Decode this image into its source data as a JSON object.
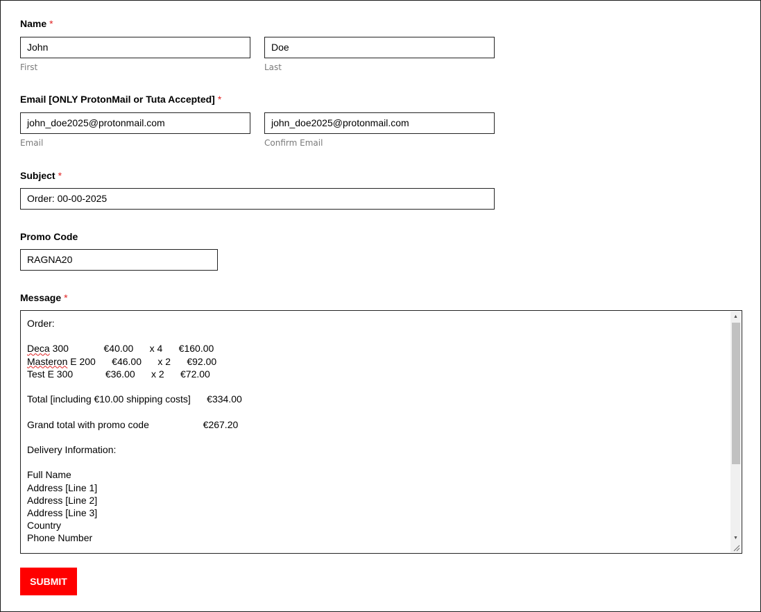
{
  "form": {
    "name": {
      "label": "Name",
      "required_mark": "*",
      "first_value": "John",
      "first_sublabel": "First",
      "last_value": "Doe",
      "last_sublabel": "Last"
    },
    "email": {
      "label": "Email [ONLY ProtonMail or Tuta Accepted]",
      "required_mark": "*",
      "email_value": "john_doe2025@protonmail.com",
      "email_sublabel": "Email",
      "confirm_value": "john_doe2025@protonmail.com",
      "confirm_sublabel": "Confirm Email"
    },
    "subject": {
      "label": "Subject",
      "required_mark": "*",
      "value": "Order: 00-00-2025"
    },
    "promo": {
      "label": "Promo Code",
      "value": "RAGNA20"
    },
    "message": {
      "label": "Message",
      "required_mark": "*",
      "lines": {
        "header": "Order:",
        "item1_name": "Deca",
        "item1_rest": " 300             €40.00      x 4      €160.00",
        "item2_name": "Masteron",
        "item2_rest": " E 200      €46.00      x 2      €92.00",
        "item3": "Test E 300            €36.00      x 2      €72.00",
        "total": "Total [including €10.00 shipping costs]      €334.00",
        "grand_total": "Grand total with promo code                    €267.20",
        "delivery_header": "Delivery Information:",
        "full_name": "Full Name",
        "address1": "Address [Line 1]",
        "address2": "Address [Line 2]",
        "address3": "Address [Line 3]",
        "country": "Country",
        "phone": "Phone Number"
      }
    },
    "submit_label": "SUBMIT"
  },
  "colors": {
    "accent": "#ff0000",
    "required": "#e02020",
    "sublabel": "#7a7a7a"
  },
  "icons": {
    "scroll_up": "triangle-up-icon",
    "scroll_down": "triangle-down-icon",
    "resize": "resize-grip-icon"
  }
}
